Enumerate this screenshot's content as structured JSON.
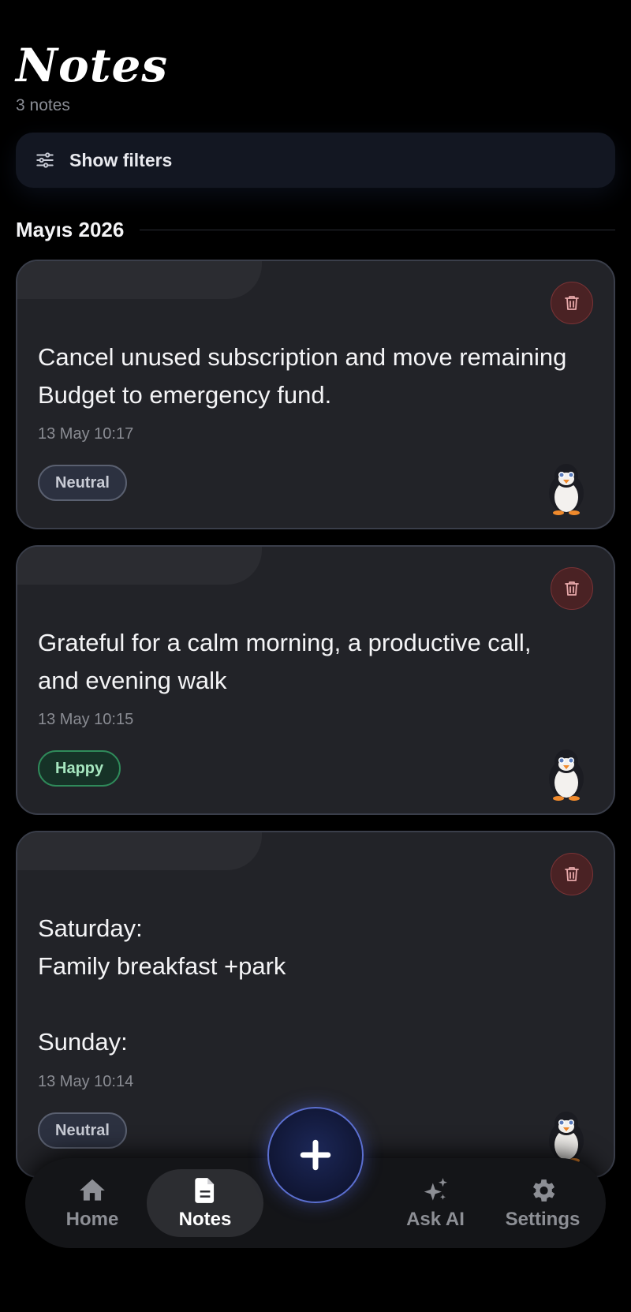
{
  "header": {
    "title": "Notes",
    "count": "3 notes"
  },
  "filters": {
    "label": "Show filters",
    "icon": "sliders-icon"
  },
  "section": {
    "title": "Mayıs 2026"
  },
  "notes": [
    {
      "text": "Cancel unused subscription and move remaining Budget to emergency fund.",
      "date": "13 May 10:17",
      "mood": "Neutral"
    },
    {
      "text": "Grateful for a calm morning, a productive call, and evening walk",
      "date": "13 May 10:15",
      "mood": "Happy"
    },
    {
      "text": "Saturday:\nFamily breakfast +park\n\nSunday:",
      "date": "13 May 10:14",
      "mood": "Neutral"
    }
  ],
  "nav": {
    "items": [
      {
        "label": "Home",
        "icon": "home-icon"
      },
      {
        "label": "Notes",
        "icon": "document-icon"
      },
      {
        "label": "Ask AI",
        "icon": "sparkles-icon"
      },
      {
        "label": "Settings",
        "icon": "gear-icon"
      }
    ],
    "active": "Notes",
    "fab_icon": "plus-icon"
  },
  "colors": {
    "background": "#000000",
    "card": "#222328",
    "accent": "#5b6fd0",
    "happy": "#2f8a5a",
    "delete": "#7a3336"
  }
}
